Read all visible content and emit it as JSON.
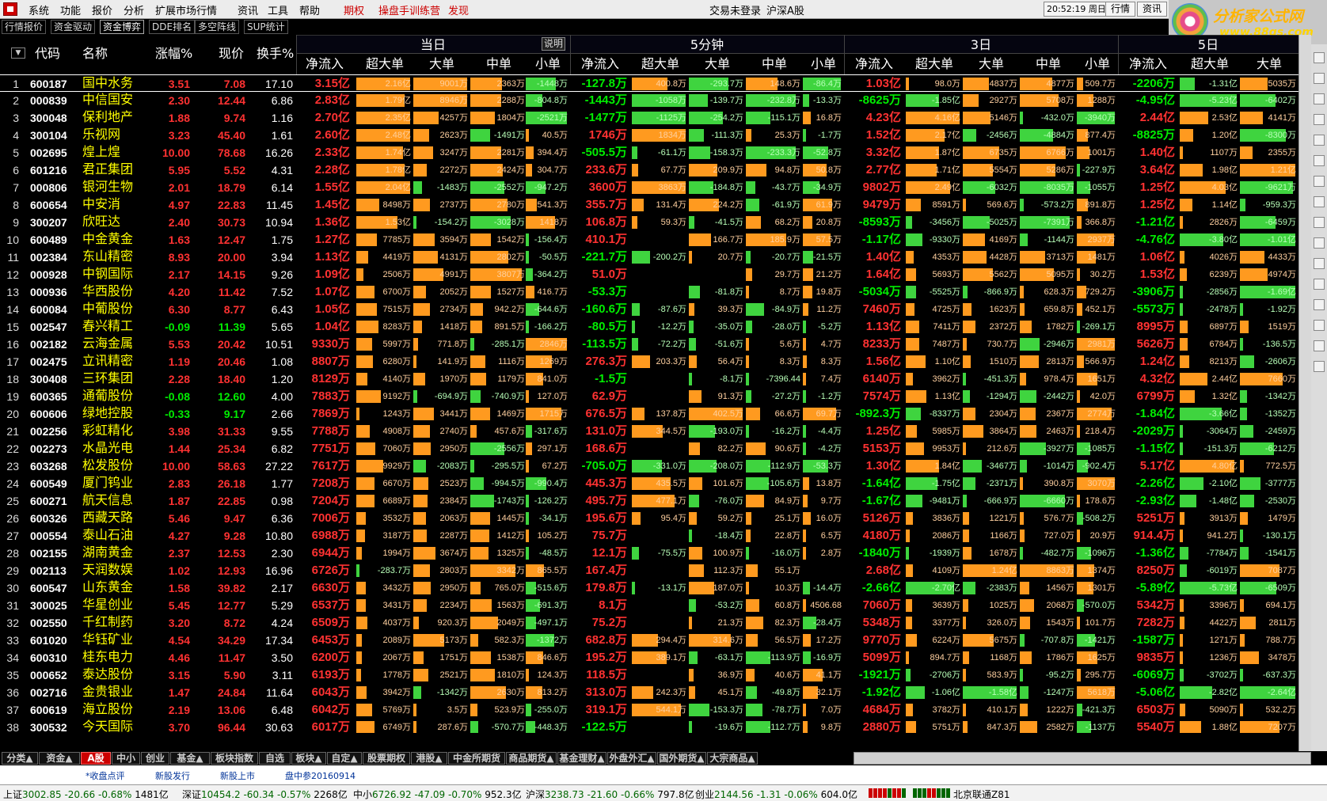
{
  "menu": {
    "items": [
      "系统",
      "功能",
      "报价",
      "分析",
      "扩展市场行情",
      "资讯",
      "工具",
      "帮助"
    ],
    "special": [
      "期权",
      "操盘手训练营",
      "发现"
    ],
    "login_status": "交易未登录",
    "market": "沪深A股",
    "clock": "20:52:19 周日",
    "buttons": [
      "行情",
      "资讯"
    ]
  },
  "brand": {
    "name": "分析家公式网",
    "url": "www.88gs.com"
  },
  "toolbar": [
    "行情报价",
    "资金驱动",
    "资金博弈",
    "DDE排名",
    "多空阵线",
    "SUP统计"
  ],
  "header": {
    "cols": [
      "代码",
      "名称",
      "涨幅%",
      "现价",
      "换手%"
    ],
    "groups": [
      "当日",
      "5分钟",
      "3日",
      "5日"
    ],
    "desc_button": "说明",
    "sub_cols": [
      "净流入",
      "超大单",
      "大单",
      "中单",
      "小单"
    ]
  },
  "table": {
    "rows": [
      [
        "1",
        "600187",
        "国中水务",
        "3.51",
        "7.08",
        "17.10",
        "3.15亿",
        "2.16亿",
        "9001万",
        "2363万",
        "-1448万",
        "-127.8万",
        "400.8万",
        "-293.7万",
        "148.6万",
        "-86.4万",
        "1.03亿",
        "98.0万",
        "4837万",
        "4877万",
        "509.7万",
        "-2206万",
        "-1.31亿",
        "5035万"
      ],
      [
        "2",
        "000839",
        "中信国安",
        "2.30",
        "12.44",
        "6.86",
        "2.83亿",
        "1.79亿",
        "8946万",
        "2288万",
        "-804.8万",
        "-1443万",
        "-1058万",
        "-139.7万",
        "-232.8万",
        "-13.3万",
        "-8625万",
        "-1.85亿",
        "2927万",
        "5708万",
        "1288万",
        "-4.95亿",
        "-5.23亿",
        "-6402万"
      ],
      [
        "3",
        "300048",
        "保利地产",
        "1.88",
        "9.74",
        "1.16",
        "2.70亿",
        "2.35亿",
        "4257万",
        "1804万",
        "-2521万",
        "-1477万",
        "-1125万",
        "-254.2万",
        "-115.1万",
        "16.8万",
        "4.23亿",
        "4.16亿",
        "5146万",
        "-432.0万",
        "-3940万",
        "2.44亿",
        "2.53亿",
        "4141万"
      ],
      [
        "4",
        "300104",
        "乐视网",
        "3.23",
        "45.40",
        "1.61",
        "2.60亿",
        "2.48亿",
        "2623万",
        "-1491万",
        "40.5万",
        "1746万",
        "1834万",
        "-111.3万",
        "25.3万",
        "-1.7万",
        "1.52亿",
        "2.17亿",
        "-2456万",
        "-4884万",
        "877.4万",
        "-8825万",
        "1.20亿",
        "-8300万"
      ],
      [
        "5",
        "002695",
        "煌上煌",
        "10.00",
        "78.68",
        "16.26",
        "2.33亿",
        "1.74亿",
        "3247万",
        "2281万",
        "394.4万",
        "-505.5万",
        "-61.1万",
        "-158.3万",
        "-233.3万",
        "-52.8万",
        "3.32亿",
        "1.87亿",
        "6735万",
        "6766万",
        "1001万",
        "1.40亿",
        "1107万",
        "2355万"
      ],
      [
        "6",
        "601216",
        "君正集团",
        "5.95",
        "5.52",
        "4.31",
        "2.28亿",
        "1.78亿",
        "2272万",
        "2424万",
        "304.7万",
        "233.6万",
        "67.7万",
        "209.9万",
        "94.8万",
        "50.8万",
        "2.77亿",
        "1.71亿",
        "5554万",
        "5286万",
        "-227.9万",
        "3.64亿",
        "1.98亿",
        "1.21亿"
      ],
      [
        "7",
        "000806",
        "银河生物",
        "2.01",
        "18.79",
        "6.14",
        "1.55亿",
        "2.04亿",
        "-1483万",
        "-2552万",
        "-947.2万",
        "3600万",
        "3863万",
        "-184.8万",
        "-43.7万",
        "-34.9万",
        "9802万",
        "2.49亿",
        "-6032万",
        "-8035万",
        "-1055万",
        "1.25亿",
        "4.03亿",
        "-9621万"
      ],
      [
        "8",
        "600654",
        "中安消",
        "4.97",
        "22.83",
        "11.45",
        "1.45亿",
        "8498万",
        "2737万",
        "2780万",
        "541.3万",
        "355.7万",
        "131.4万",
        "224.2万",
        "-61.9万",
        "61.9万",
        "9479万",
        "8591万",
        "569.6万",
        "-573.2万",
        "891.8万",
        "1.25亿",
        "1.14亿",
        "-959.3万"
      ],
      [
        "9",
        "300207",
        "欣旺达",
        "2.40",
        "30.73",
        "10.94",
        "1.36亿",
        "1.53亿",
        "-154.2万",
        "-3028万",
        "1418万",
        "106.8万",
        "59.3万",
        "-41.5万",
        "68.2万",
        "20.8万",
        "-8593万",
        "-3456万",
        "-5025万",
        "-7391万",
        "366.8万",
        "-1.21亿",
        "2826万",
        "-6459万"
      ],
      [
        "10",
        "600489",
        "中金黄金",
        "1.63",
        "12.47",
        "1.75",
        "1.27亿",
        "7785万",
        "3594万",
        "1542万",
        "-156.4万",
        "410.1万",
        "",
        "166.7万",
        "185.9万",
        "57.5万",
        "-1.17亿",
        "-9330万",
        "4169万",
        "-1144万",
        "2937万",
        "-4.76亿",
        "-3.80亿",
        "-1.01亿"
      ],
      [
        "11",
        "002384",
        "东山精密",
        "8.93",
        "20.00",
        "3.94",
        "1.13亿",
        "4419万",
        "4131万",
        "2802万",
        "-50.5万",
        "-221.7万",
        "-200.2万",
        "20.7万",
        "-20.7万",
        "-21.5万",
        "1.40亿",
        "4353万",
        "4428万",
        "3713万",
        "1481万",
        "1.06亿",
        "4026万",
        "4433万"
      ],
      [
        "12",
        "000928",
        "中钢国际",
        "2.17",
        "14.15",
        "9.26",
        "1.09亿",
        "2506万",
        "4991万",
        "3807万",
        "-364.2万",
        "51.0万",
        "",
        "",
        "29.7万",
        "21.2万",
        "1.64亿",
        "5693万",
        "5562万",
        "5095万",
        "30.2万",
        "1.53亿",
        "6239万",
        "4974万"
      ],
      [
        "13",
        "000936",
        "华西股份",
        "4.20",
        "11.42",
        "7.52",
        "1.07亿",
        "6700万",
        "2052万",
        "1527万",
        "416.7万",
        "-53.3万",
        "",
        "-81.8万",
        "8.7万",
        "19.8万",
        "-5034万",
        "-5525万",
        "-866.9万",
        "628.3万",
        "729.2万",
        "-3906万",
        "-2856万",
        "-1.69亿"
      ],
      [
        "14",
        "600084",
        "中葡股份",
        "6.30",
        "8.77",
        "6.43",
        "1.05亿",
        "7515万",
        "2734万",
        "942.2万",
        "-644.6万",
        "-160.6万",
        "-87.6万",
        "39.3万",
        "-84.9万",
        "11.2万",
        "7460万",
        "4725万",
        "1623万",
        "659.8万",
        "452.1万",
        "-5573万",
        "-2478万",
        "-1.92万"
      ],
      [
        "15",
        "002547",
        "春兴精工",
        "-0.09",
        "11.39",
        "5.65",
        "1.04亿",
        "8283万",
        "1418万",
        "891.5万",
        "-166.2万",
        "-80.5万",
        "-12.2万",
        "-35.0万",
        "-28.0万",
        "-5.2万",
        "1.13亿",
        "7411万",
        "2372万",
        "1782万",
        "-269.1万",
        "8995万",
        "6897万",
        "1519万"
      ],
      [
        "16",
        "002182",
        "云海金属",
        "5.53",
        "20.42",
        "10.51",
        "9330万",
        "5997万",
        "771.8万",
        "-285.1万",
        "2846万",
        "-113.5万",
        "-72.2万",
        "-51.6万",
        "5.6万",
        "4.7万",
        "8233万",
        "7487万",
        "730.7万",
        "-2946万",
        "2981万",
        "5626万",
        "6784万",
        "-136.5万"
      ],
      [
        "17",
        "002475",
        "立讯精密",
        "1.19",
        "20.46",
        "1.08",
        "8807万",
        "6280万",
        "141.9万",
        "1116万",
        "1269万",
        "276.3万",
        "203.3万",
        "56.4万",
        "8.3万",
        "8.3万",
        "1.56亿",
        "1.10亿",
        "1510万",
        "2813万",
        "566.9万",
        "1.24亿",
        "8213万",
        "-2606万"
      ],
      [
        "18",
        "300408",
        "三环集团",
        "2.28",
        "18.40",
        "1.20",
        "8129万",
        "4140万",
        "1970万",
        "1179万",
        "841.0万",
        "-1.5万",
        "",
        "-8.1万",
        "-7396.44",
        "7.4万",
        "6140万",
        "3962万",
        "-451.3万",
        "978.4万",
        "1651万",
        "4.32亿",
        "2.44亿",
        "7660万"
      ],
      [
        "19",
        "600365",
        "通葡股份",
        "-0.08",
        "12.60",
        "4.00",
        "7883万",
        "9192万",
        "-694.9万",
        "-740.9万",
        "127.0万",
        "62.9万",
        "",
        "91.3万",
        "-27.2万",
        "-1.2万",
        "7574万",
        "1.13亿",
        "-1294万",
        "-2442万",
        "42.0万",
        "6799万",
        "1.32亿",
        "-1342万"
      ],
      [
        "20",
        "600606",
        "绿地控股",
        "-0.33",
        "9.17",
        "2.66",
        "7869万",
        "1243万",
        "3441万",
        "1469万",
        "1715万",
        "676.5万",
        "137.8万",
        "402.5万",
        "66.6万",
        "69.7万",
        "-892.3万",
        "-8337万",
        "2304万",
        "2367万",
        "2774万",
        "-1.84亿",
        "-3.66亿",
        "-1352万"
      ],
      [
        "21",
        "002256",
        "彩虹精化",
        "3.98",
        "31.33",
        "9.55",
        "7788万",
        "4908万",
        "2740万",
        "457.6万",
        "-317.6万",
        "131.0万",
        "344.5万",
        "-193.0万",
        "-16.2万",
        "-4.4万",
        "1.25亿",
        "5985万",
        "3864万",
        "2463万",
        "218.4万",
        "-2029万",
        "-3064万",
        "-2459万"
      ],
      [
        "22",
        "002273",
        "水晶光电",
        "1.44",
        "25.34",
        "6.82",
        "7751万",
        "7060万",
        "2950万",
        "-2556万",
        "297.1万",
        "168.6万",
        "",
        "82.2万",
        "90.6万",
        "-4.2万",
        "5153万",
        "9953万",
        "212.6万",
        "-3927万",
        "-1085万",
        "-1.15亿",
        "-151.3万",
        "-6212万"
      ],
      [
        "23",
        "603268",
        "松发股份",
        "10.00",
        "58.63",
        "27.22",
        "7617万",
        "9929万",
        "-2083万",
        "-295.5万",
        "67.2万",
        "-705.0万",
        "-331.0万",
        "-208.0万",
        "-112.9万",
        "-53.3万",
        "1.30亿",
        "1.84亿",
        "-3467万",
        "-1014万",
        "-902.4万",
        "5.17亿",
        "4.80亿",
        "772.5万"
      ],
      [
        "24",
        "600549",
        "厦门钨业",
        "2.83",
        "26.18",
        "1.77",
        "7208万",
        "6670万",
        "2523万",
        "-994.5万",
        "-990.4万",
        "445.3万",
        "435.5万",
        "101.6万",
        "-105.6万",
        "13.8万",
        "-1.64亿",
        "-1.75亿",
        "-2371万",
        "390.8万",
        "3070万",
        "-2.26亿",
        "-2.10亿",
        "-3777万"
      ],
      [
        "25",
        "600271",
        "航天信息",
        "1.87",
        "22.85",
        "0.98",
        "7204万",
        "6689万",
        "2384万",
        "-1743万",
        "-126.2万",
        "495.7万",
        "477.1万",
        "-76.0万",
        "84.9万",
        "9.7万",
        "-1.67亿",
        "-9481万",
        "-666.9万",
        "-6660万",
        "178.6万",
        "-2.93亿",
        "-1.48亿",
        "-2530万"
      ],
      [
        "26",
        "600326",
        "西藏天路",
        "5.46",
        "9.47",
        "6.36",
        "7006万",
        "3532万",
        "2063万",
        "1445万",
        "-34.1万",
        "195.6万",
        "95.4万",
        "59.2万",
        "25.1万",
        "16.0万",
        "5126万",
        "3836万",
        "1221万",
        "576.7万",
        "-508.2万",
        "5251万",
        "3913万",
        "1479万"
      ],
      [
        "27",
        "000554",
        "泰山石油",
        "4.27",
        "9.28",
        "10.80",
        "6988万",
        "3187万",
        "2287万",
        "1412万",
        "105.2万",
        "75.7万",
        "",
        "-18.4万",
        "22.8万",
        "6.5万",
        "4180万",
        "2086万",
        "1166万",
        "727.0万",
        "20.9万",
        "914.4万",
        "941.2万",
        "-130.1万"
      ],
      [
        "28",
        "002155",
        "湖南黄金",
        "2.37",
        "12.53",
        "2.30",
        "6944万",
        "1994万",
        "3674万",
        "1325万",
        "-48.5万",
        "12.1万",
        "-75.5万",
        "100.9万",
        "-16.0万",
        "2.8万",
        "-1840万",
        "-1939万",
        "1678万",
        "-482.7万",
        "-1096万",
        "-1.36亿",
        "-7784万",
        "-1541万"
      ],
      [
        "29",
        "002113",
        "天润数娱",
        "1.02",
        "12.93",
        "16.96",
        "6726万",
        "-283.7万",
        "2803万",
        "3342万",
        "865.5万",
        "167.4万",
        "",
        "112.3万",
        "55.1万",
        "",
        "2.68亿",
        "4109万",
        "1.24亿",
        "8863万",
        "1374万",
        "8250万",
        "-6019万",
        "7087万"
      ],
      [
        "30",
        "600547",
        "山东黄金",
        "1.58",
        "39.82",
        "2.17",
        "6630万",
        "3432万",
        "2950万",
        "765.0万",
        "-515.6万",
        "179.8万",
        "-13.1万",
        "187.0万",
        "10.3万",
        "-14.4万",
        "-2.66亿",
        "-2.70亿",
        "-2383万",
        "1456万",
        "1301万",
        "-5.89亿",
        "-5.73亿",
        "-6509万"
      ],
      [
        "31",
        "300025",
        "华星创业",
        "5.45",
        "12.77",
        "5.29",
        "6537万",
        "3431万",
        "2234万",
        "1563万",
        "-691.3万",
        "8.1万",
        "",
        "-53.2万",
        "60.8万",
        "4506.68",
        "7060万",
        "3639万",
        "1025万",
        "2068万",
        "-570.0万",
        "5342万",
        "3396万",
        "694.1万"
      ],
      [
        "32",
        "002550",
        "千红制药",
        "3.20",
        "8.72",
        "4.24",
        "6509万",
        "4037万",
        "920.3万",
        "2049万",
        "-497.1万",
        "75.2万",
        "",
        "21.3万",
        "82.3万",
        "-28.4万",
        "5348万",
        "3377万",
        "326.0万",
        "1543万",
        "101.7万",
        "7282万",
        "4422万",
        "2811万"
      ],
      [
        "33",
        "601020",
        "华钰矿业",
        "4.54",
        "34.29",
        "17.34",
        "6453万",
        "2089万",
        "5173万",
        "582.3万",
        "-1372万",
        "682.8万",
        "294.4万",
        "314.6万",
        "56.5万",
        "17.2万",
        "9770万",
        "6224万",
        "5675万",
        "-707.8万",
        "-1421万",
        "-1587万",
        "1271万",
        "788.7万"
      ],
      [
        "34",
        "600310",
        "桂东电力",
        "4.46",
        "11.47",
        "3.50",
        "6200万",
        "2067万",
        "1751万",
        "1538万",
        "846.6万",
        "195.2万",
        "389.1万",
        "-63.1万",
        "-113.9万",
        "-16.9万",
        "5099万",
        "894.7万",
        "1168万",
        "1786万",
        "1625万",
        "9835万",
        "1236万",
        "3478万"
      ],
      [
        "35",
        "000652",
        "泰达股份",
        "3.15",
        "5.90",
        "3.11",
        "6193万",
        "1778万",
        "2521万",
        "1810万",
        "124.3万",
        "118.5万",
        "",
        "36.9万",
        "40.6万",
        "41.1万",
        "-1921万",
        "-2706万",
        "583.9万",
        "-95.2万",
        "295.7万",
        "-6069万",
        "-3702万",
        "-637.3万"
      ],
      [
        "36",
        "002716",
        "金贵银业",
        "1.47",
        "24.84",
        "11.64",
        "6043万",
        "3942万",
        "-1342万",
        "2630万",
        "813.2万",
        "313.0万",
        "242.3万",
        "45.1万",
        "-49.8万",
        "32.1万",
        "-1.92亿",
        "-1.06亿",
        "-1.58亿",
        "-1247万",
        "5618万",
        "-5.06亿",
        "-2.82亿",
        "-2.64亿"
      ],
      [
        "37",
        "600619",
        "海立股份",
        "2.19",
        "13.06",
        "6.48",
        "6042万",
        "5769万",
        "3.5万",
        "523.9万",
        "-255.0万",
        "319.1万",
        "544.1万",
        "-153.3万",
        "-78.7万",
        "7.0万",
        "4684万",
        "3782万",
        "410.1万",
        "1222万",
        "-421.3万",
        "6503万",
        "5090万",
        "532.2万"
      ],
      [
        "38",
        "300532",
        "今天国际",
        "3.70",
        "96.44",
        "30.63",
        "6017万",
        "6749万",
        "287.6万",
        "-570.7万",
        "-448.3万",
        "-122.5万",
        "",
        "-19.6万",
        "-112.7万",
        "9.8万",
        "2880万",
        "5751万",
        "847.3万",
        "2582万",
        "-1137万",
        "5540万",
        "1.88亿",
        "7207万"
      ]
    ]
  },
  "tabs": [
    "分类▲",
    "资金▲",
    "A股",
    "中小",
    "创业",
    "基金▲",
    "板块指数",
    "自选",
    "板块▲",
    "自定▲",
    "股票期权",
    "港股▲",
    "中金所期货",
    "商品期货▲",
    "基金理财▲",
    "外盘外汇▲",
    "国外期货▲",
    "大宗商品▲"
  ],
  "news": [
    "*收盘点评",
    "新股发行",
    "新股上市",
    "盘中参20160914"
  ],
  "status": {
    "sh": {
      "label": "上证",
      "value": "3002.85",
      "chg": "-20.66",
      "pct": "-0.68%",
      "amt": "1481亿"
    },
    "sz": {
      "label": "深证",
      "value": "10454.2",
      "chg": "-60.34",
      "pct": "-0.57%",
      "amt": "2268亿"
    },
    "zx": {
      "label": "中小",
      "value": "6726.92",
      "chg": "-47.09",
      "pct": "-0.70%",
      "amt": "952.3亿"
    },
    "hs": {
      "label": "沪深",
      "value": "3238.73",
      "chg": "-21.60",
      "pct": "-0.66%",
      "amt": "797.8亿"
    },
    "cy": {
      "label": "创业",
      "value": "2144.56",
      "chg": "-1.31",
      "pct": "-0.06%",
      "amt": "604.0亿"
    },
    "server": "北京联通Z81"
  },
  "colors": {
    "up": "#ff3232",
    "down": "#00ee00",
    "bar_orange": "#ff9a1f",
    "bar_green": "#3fd43f",
    "name": "#ffff00",
    "active_tab": "#cc0000"
  }
}
